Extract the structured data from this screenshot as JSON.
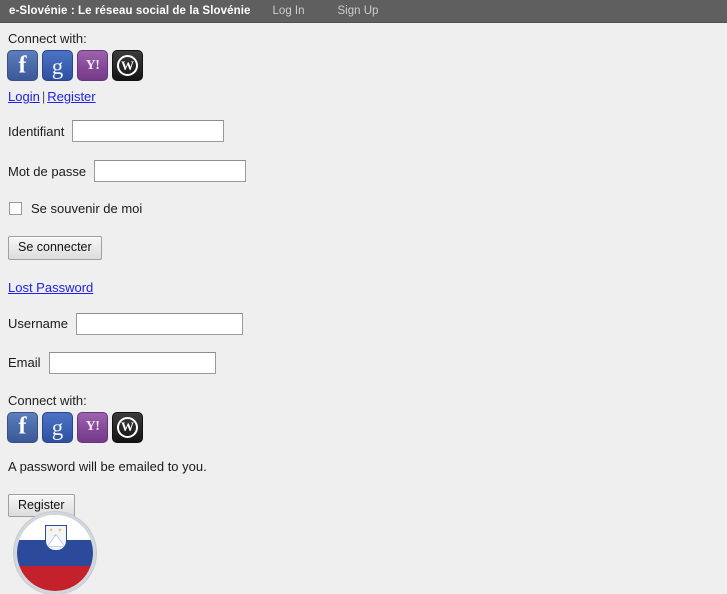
{
  "adminbar": {
    "site_title": "e-Slovénie : Le réseau social de la Slovénie",
    "links": [
      {
        "label": "Log In",
        "name": "adminbar-login-link"
      },
      {
        "label": "Sign Up",
        "name": "adminbar-signup-link"
      }
    ]
  },
  "colors": {
    "adminbar_bg": "#5f5f5f",
    "page_bg": "#efefef",
    "link": "#2020ee",
    "text": "#1a1a1a",
    "facebook": "#3b5998",
    "google": "#2f4f9e",
    "yahoo": "#733c87",
    "wordpress": "#141414",
    "flag_blue": "#2b4a9b",
    "flag_red": "#c5212c"
  },
  "login_section": {
    "connect_label": "Connect with:",
    "social": [
      {
        "icon": "facebook-icon",
        "label": "Facebook"
      },
      {
        "icon": "google-icon",
        "label": "Google"
      },
      {
        "icon": "yahoo-icon",
        "label": "Yahoo"
      },
      {
        "icon": "wordpress-icon",
        "label": "WordPress",
        "glyph": "W"
      }
    ],
    "login_link": "Login",
    "separator": "|",
    "register_link": "Register",
    "username_label": "Identifiant",
    "username_value": "",
    "password_label": "Mot de passe",
    "password_value": "",
    "remember_label": "Se souvenir de moi",
    "remember_checked": false,
    "submit_label": "Se connecter",
    "lost_password_label": "Lost Password"
  },
  "register_section": {
    "username_label": "Username",
    "username_value": "",
    "email_label": "Email",
    "email_value": "",
    "connect_label": "Connect with:",
    "social": [
      {
        "icon": "facebook-icon",
        "label": "Facebook"
      },
      {
        "icon": "google-icon",
        "label": "Google"
      },
      {
        "icon": "yahoo-icon",
        "label": "Yahoo"
      },
      {
        "icon": "wordpress-icon",
        "label": "WordPress",
        "glyph": "W"
      }
    ],
    "note": "A password will be emailed to you.",
    "submit_label": "Register"
  },
  "site_logo": {
    "name": "slovenia-flag-logo",
    "stars": "✦ ✦ ✦"
  }
}
